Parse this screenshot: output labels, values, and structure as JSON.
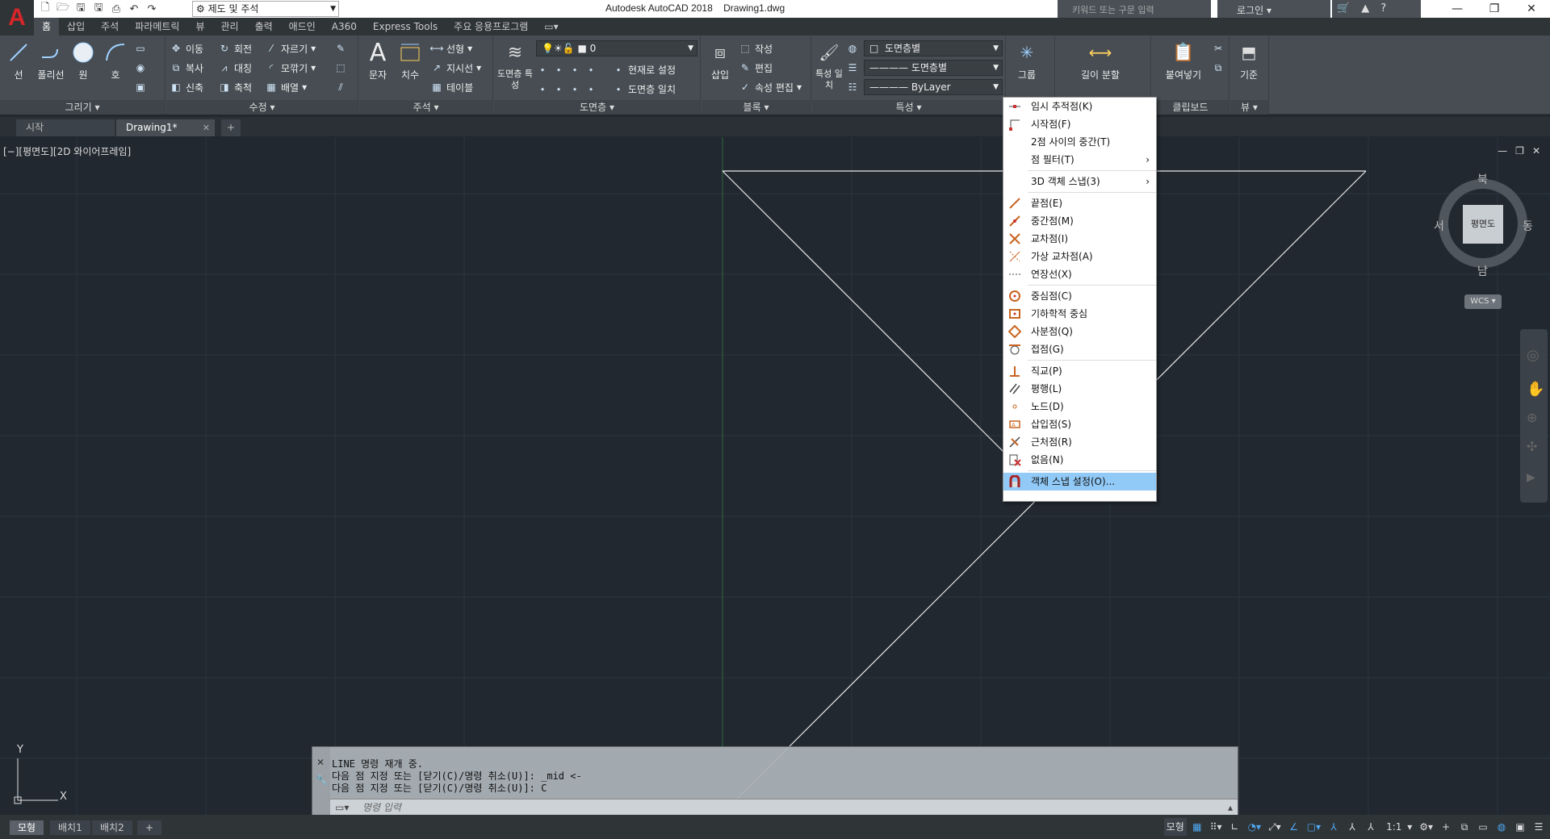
{
  "title_bar": {
    "workspace": "제도 및 주석",
    "app_title": "Autodesk AutoCAD 2018",
    "file_name": "Drawing1.dwg",
    "search_placeholder": "키워드 또는 구문 입력",
    "login": "로그인"
  },
  "ribbon_tabs": [
    "홈",
    "삽입",
    "주석",
    "파라메트릭",
    "뷰",
    "관리",
    "출력",
    "애드인",
    "A360",
    "Express Tools",
    "주요 응용프로그램"
  ],
  "ribbon": {
    "draw": {
      "title": "그리기",
      "line": "선",
      "polyline": "폴리선",
      "circle": "원",
      "arc": "호"
    },
    "modify": {
      "title": "수정",
      "move": "이동",
      "rotate": "회전",
      "trim": "자르기",
      "copy": "복사",
      "mirror": "대칭",
      "fillet": "모깎기",
      "stretch": "신축",
      "scale": "축척",
      "array": "배열"
    },
    "annotation": {
      "title": "주석",
      "text": "문자",
      "dimension": "치수",
      "linear": "선형",
      "leader": "지시선",
      "table": "테이블"
    },
    "layers": {
      "title": "도면층",
      "properties": "도면층 특성",
      "current_layer": "0",
      "make_current": "현재로 설정",
      "match_layer": "도면층 일치"
    },
    "block": {
      "title": "블록",
      "insert": "삽입",
      "create": "작성",
      "edit": "편집",
      "edit_attr": "속성 편집"
    },
    "properties": {
      "title": "특성",
      "match": "특성 일치",
      "color": "도면층별",
      "linetype": "도면층별",
      "lineweight": "ByLayer"
    },
    "groups": {
      "title": "그룹",
      "group": "그룹"
    },
    "utilities": {
      "measure": "길이 분할"
    },
    "clipboard": {
      "title": "클립보드",
      "paste": "붙여넣기"
    },
    "view": {
      "title": "뷰",
      "base": "기준"
    }
  },
  "doc_tabs": [
    "시작",
    "Drawing1*"
  ],
  "viewport_label": "[−][평면도][2D 와이어프레임]",
  "viewcube": {
    "north": "북",
    "south": "남",
    "east": "동",
    "west": "서",
    "face": "평면도",
    "wcs": "WCS"
  },
  "osnap_menu": {
    "items": [
      {
        "label": "임시 추적점(K)",
        "icon": "temp-track-icon"
      },
      {
        "label": "시작점(F)",
        "icon": "from-icon"
      },
      {
        "label": "2점 사이의 중간(T)",
        "icon": ""
      },
      {
        "label": "점 필터(T)",
        "icon": "",
        "submenu": true
      },
      {
        "sep": true
      },
      {
        "label": "3D 객체 스냅(3)",
        "icon": "",
        "submenu": true
      },
      {
        "sep": true
      },
      {
        "label": "끝점(E)",
        "icon": "endpoint-icon"
      },
      {
        "label": "중간점(M)",
        "icon": "midpoint-icon"
      },
      {
        "label": "교차점(I)",
        "icon": "intersection-icon"
      },
      {
        "label": "가상 교차점(A)",
        "icon": "apparent-intersection-icon"
      },
      {
        "label": "연장선(X)",
        "icon": "extension-icon"
      },
      {
        "sep": true
      },
      {
        "label": "중심점(C)",
        "icon": "center-icon"
      },
      {
        "label": "기하학적 중심",
        "icon": "geometric-center-icon"
      },
      {
        "label": "사분점(Q)",
        "icon": "quadrant-icon"
      },
      {
        "label": "접점(G)",
        "icon": "tangent-icon"
      },
      {
        "sep": true
      },
      {
        "label": "직교(P)",
        "icon": "perpendicular-icon"
      },
      {
        "label": "평행(L)",
        "icon": "parallel-icon"
      },
      {
        "label": "노드(D)",
        "icon": "node-icon"
      },
      {
        "label": "삽입점(S)",
        "icon": "insertion-icon"
      },
      {
        "label": "근처점(R)",
        "icon": "nearest-icon"
      },
      {
        "label": "없음(N)",
        "icon": "none-icon"
      },
      {
        "sep": true
      },
      {
        "label": "객체 스냅 설정(O)...",
        "icon": "osnap-settings-icon",
        "highlighted": true
      }
    ]
  },
  "command": {
    "lines": [
      "LINE 명령 재개 중.",
      "다음 점 지정 또는 [닫기(C)/명령 취소(U)]: _mid <-",
      "다음 점 지정 또는 [닫기(C)/명령 취소(U)]: C"
    ],
    "placeholder": "명령 입력"
  },
  "layout_tabs": [
    "모형",
    "배치1",
    "배치2"
  ],
  "status": {
    "model": "모형",
    "scale": "1:1"
  },
  "ucs": {
    "y": "Y",
    "x": "X"
  }
}
